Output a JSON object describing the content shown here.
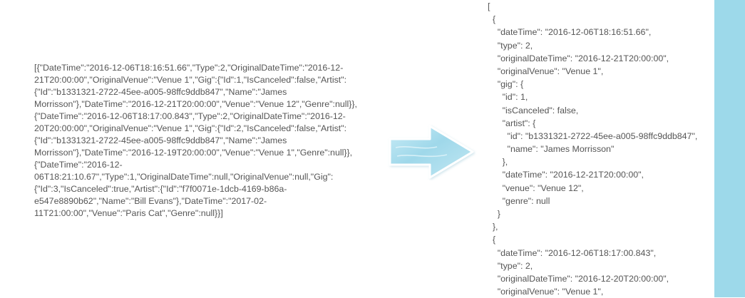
{
  "raw_json": {
    "lines": [
      "[{\"DateTime\":\"2016-12-06T18:16:51.66\",\"Type\":2,\"OriginalDateTime\":\"2016-12-",
      "21T20:00:00\",\"OriginalVenue\":\"Venue 1\",\"Gig\":{\"Id\":1,\"IsCanceled\":false,\"Artist\":",
      "{\"Id\":\"b1331321-2722-45ee-a005-98ffc9ddb847\",\"Name\":\"James",
      "Morrisson\"},\"DateTime\":\"2016-12-21T20:00:00\",\"Venue\":\"Venue 12\",\"Genre\":null}},",
      "{\"DateTime\":\"2016-12-06T18:17:00.843\",\"Type\":2,\"OriginalDateTime\":\"2016-12-",
      "20T20:00:00\",\"OriginalVenue\":\"Venue 1\",\"Gig\":{\"Id\":2,\"IsCanceled\":false,\"Artist\":",
      "{\"Id\":\"b1331321-2722-45ee-a005-98ffc9ddb847\",\"Name\":\"James",
      "Morrisson\"},\"DateTime\":\"2016-12-19T20:00:00\",\"Venue\":\"Venue 1\",\"Genre\":null}},",
      "{\"DateTime\":\"2016-12-",
      "06T18:21:10.67\",\"Type\":1,\"OriginalDateTime\":null,\"OriginalVenue\":null,\"Gig\":",
      "{\"Id\":3,\"IsCanceled\":true,\"Artist\":{\"Id\":\"f7f0071e-1dcb-4169-b86a-",
      "e547e8890b62\",\"Name\":\"Bill Evans\"},\"DateTime\":\"2017-02-",
      "11T21:00:00\",\"Venue\":\"Paris Cat\",\"Genre\":null}}]"
    ]
  },
  "pretty_json": {
    "lines": [
      "[",
      "  {",
      "    \"dateTime\": \"2016-12-06T18:16:51.66\",",
      "    \"type\": 2,",
      "    \"originalDateTime\": \"2016-12-21T20:00:00\",",
      "    \"originalVenue\": \"Venue 1\",",
      "    \"gig\": {",
      "      \"id\": 1,",
      "      \"isCanceled\": false,",
      "      \"artist\": {",
      "        \"id\": \"b1331321-2722-45ee-a005-98ffc9ddb847\",",
      "        \"name\": \"James Morrisson\"",
      "      },",
      "      \"dateTime\": \"2016-12-21T20:00:00\",",
      "      \"venue\": \"Venue 12\",",
      "      \"genre\": null",
      "    }",
      "  },",
      "  {",
      "    \"dateTime\": \"2016-12-06T18:17:00.843\",",
      "    \"type\": 2,",
      "    \"originalDateTime\": \"2016-12-20T20:00:00\",",
      "    \"originalVenue\": \"Venue 1\","
    ]
  },
  "colors": {
    "text": "#555555",
    "arrow_fill": "#a8dcec",
    "side_bar": "#9dd9ea"
  },
  "icons": {
    "arrow": "arrow-right-icon"
  }
}
